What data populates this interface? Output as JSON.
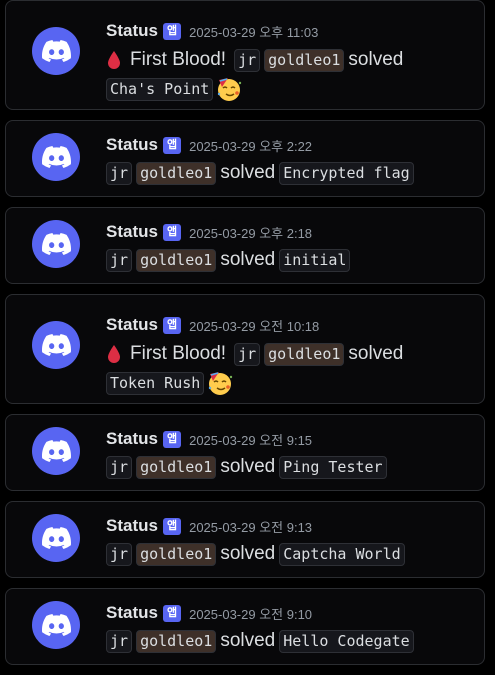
{
  "theme": {
    "avatar_color": "#5865f2",
    "app_tag_color": "#5865f2",
    "background": "#000000"
  },
  "messages": [
    {
      "username": "Status",
      "app_tag": "앱",
      "timestamp": "2025-03-29 오후 11:03",
      "first_blood": true,
      "first_blood_text": "First Blood!",
      "category": "jr",
      "user": "goldleo1",
      "verb": "solved",
      "challenge": "Cha's Point",
      "celebrate_icon": "partying-face-icon"
    },
    {
      "username": "Status",
      "app_tag": "앱",
      "timestamp": "2025-03-29 오후 2:22",
      "first_blood": false,
      "category": "jr",
      "user": "goldleo1",
      "verb": "solved",
      "challenge": "Encrypted flag"
    },
    {
      "username": "Status",
      "app_tag": "앱",
      "timestamp": "2025-03-29 오후 2:18",
      "first_blood": false,
      "category": "jr",
      "user": "goldleo1",
      "verb": "solved",
      "challenge": "initial"
    },
    {
      "username": "Status",
      "app_tag": "앱",
      "timestamp": "2025-03-29 오전 10:18",
      "first_blood": true,
      "first_blood_text": "First Blood!",
      "category": "jr",
      "user": "goldleo1",
      "verb": "solved",
      "challenge": "Token Rush",
      "celebrate_icon": "partying-face-icon"
    },
    {
      "username": "Status",
      "app_tag": "앱",
      "timestamp": "2025-03-29 오전 9:15",
      "first_blood": false,
      "category": "jr",
      "user": "goldleo1",
      "verb": "solved",
      "challenge": "Ping Tester"
    },
    {
      "username": "Status",
      "app_tag": "앱",
      "timestamp": "2025-03-29 오전 9:13",
      "first_blood": false,
      "category": "jr",
      "user": "goldleo1",
      "verb": "solved",
      "challenge": "Captcha World"
    },
    {
      "username": "Status",
      "app_tag": "앱",
      "timestamp": "2025-03-29 오전 9:10",
      "first_blood": false,
      "category": "jr",
      "user": "goldleo1",
      "verb": "solved",
      "challenge": "Hello Codegate"
    }
  ]
}
